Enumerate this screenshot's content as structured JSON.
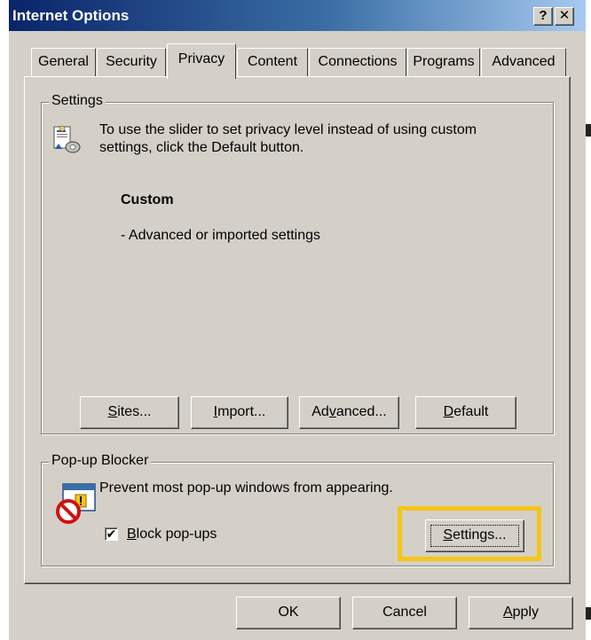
{
  "window": {
    "title": "Internet Options",
    "help_label": "?",
    "close_label": "✕"
  },
  "tabs": [
    {
      "label": "General",
      "active": false
    },
    {
      "label": "Security",
      "active": false
    },
    {
      "label": "Privacy",
      "active": true
    },
    {
      "label": "Content",
      "active": false
    },
    {
      "label": "Connections",
      "active": false
    },
    {
      "label": "Programs",
      "active": false
    },
    {
      "label": "Advanced",
      "active": false
    }
  ],
  "settings_group": {
    "label": "Settings",
    "description": "To use the slider to set privacy level instead of using custom settings, click the Default button.",
    "level_title": "Custom",
    "level_description": "- Advanced or imported settings",
    "buttons": {
      "sites": {
        "pre": "",
        "u": "S",
        "post": "ites..."
      },
      "import": {
        "pre": "",
        "u": "I",
        "post": "mport..."
      },
      "advanced": {
        "pre": "Ad",
        "u": "v",
        "post": "anced..."
      },
      "default": {
        "pre": "",
        "u": "D",
        "post": "efault"
      }
    }
  },
  "popup_group": {
    "label": "Pop-up Blocker",
    "description": "Prevent most pop-up windows from appearing.",
    "checkbox": {
      "checked": true,
      "mark": "✔",
      "pre": "",
      "u": "B",
      "post": "lock pop-ups"
    },
    "settings_button": {
      "pre": "",
      "u": "S",
      "post": "ettings..."
    }
  },
  "footer": {
    "ok": "OK",
    "cancel": "Cancel",
    "apply": {
      "pre": "",
      "u": "A",
      "post": "pply"
    }
  },
  "colors": {
    "face": "#d4d0c8",
    "title_start": "#0a246a",
    "title_end": "#a6caf0",
    "highlight": "#f5c518"
  }
}
